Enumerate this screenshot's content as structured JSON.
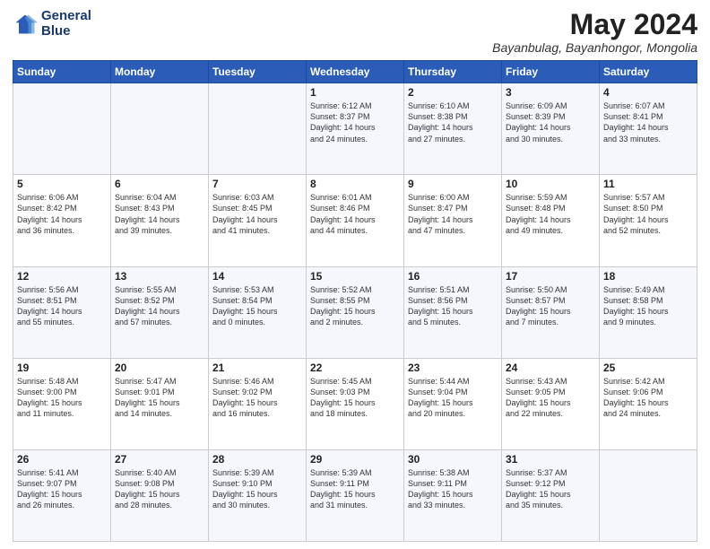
{
  "logo": {
    "line1": "General",
    "line2": "Blue"
  },
  "title": "May 2024",
  "subtitle": "Bayanbulag, Bayanhongor, Mongolia",
  "weekdays": [
    "Sunday",
    "Monday",
    "Tuesday",
    "Wednesday",
    "Thursday",
    "Friday",
    "Saturday"
  ],
  "weeks": [
    [
      {
        "day": "",
        "info": ""
      },
      {
        "day": "",
        "info": ""
      },
      {
        "day": "",
        "info": ""
      },
      {
        "day": "1",
        "info": "Sunrise: 6:12 AM\nSunset: 8:37 PM\nDaylight: 14 hours\nand 24 minutes."
      },
      {
        "day": "2",
        "info": "Sunrise: 6:10 AM\nSunset: 8:38 PM\nDaylight: 14 hours\nand 27 minutes."
      },
      {
        "day": "3",
        "info": "Sunrise: 6:09 AM\nSunset: 8:39 PM\nDaylight: 14 hours\nand 30 minutes."
      },
      {
        "day": "4",
        "info": "Sunrise: 6:07 AM\nSunset: 8:41 PM\nDaylight: 14 hours\nand 33 minutes."
      }
    ],
    [
      {
        "day": "5",
        "info": "Sunrise: 6:06 AM\nSunset: 8:42 PM\nDaylight: 14 hours\nand 36 minutes."
      },
      {
        "day": "6",
        "info": "Sunrise: 6:04 AM\nSunset: 8:43 PM\nDaylight: 14 hours\nand 39 minutes."
      },
      {
        "day": "7",
        "info": "Sunrise: 6:03 AM\nSunset: 8:45 PM\nDaylight: 14 hours\nand 41 minutes."
      },
      {
        "day": "8",
        "info": "Sunrise: 6:01 AM\nSunset: 8:46 PM\nDaylight: 14 hours\nand 44 minutes."
      },
      {
        "day": "9",
        "info": "Sunrise: 6:00 AM\nSunset: 8:47 PM\nDaylight: 14 hours\nand 47 minutes."
      },
      {
        "day": "10",
        "info": "Sunrise: 5:59 AM\nSunset: 8:48 PM\nDaylight: 14 hours\nand 49 minutes."
      },
      {
        "day": "11",
        "info": "Sunrise: 5:57 AM\nSunset: 8:50 PM\nDaylight: 14 hours\nand 52 minutes."
      }
    ],
    [
      {
        "day": "12",
        "info": "Sunrise: 5:56 AM\nSunset: 8:51 PM\nDaylight: 14 hours\nand 55 minutes."
      },
      {
        "day": "13",
        "info": "Sunrise: 5:55 AM\nSunset: 8:52 PM\nDaylight: 14 hours\nand 57 minutes."
      },
      {
        "day": "14",
        "info": "Sunrise: 5:53 AM\nSunset: 8:54 PM\nDaylight: 15 hours\nand 0 minutes."
      },
      {
        "day": "15",
        "info": "Sunrise: 5:52 AM\nSunset: 8:55 PM\nDaylight: 15 hours\nand 2 minutes."
      },
      {
        "day": "16",
        "info": "Sunrise: 5:51 AM\nSunset: 8:56 PM\nDaylight: 15 hours\nand 5 minutes."
      },
      {
        "day": "17",
        "info": "Sunrise: 5:50 AM\nSunset: 8:57 PM\nDaylight: 15 hours\nand 7 minutes."
      },
      {
        "day": "18",
        "info": "Sunrise: 5:49 AM\nSunset: 8:58 PM\nDaylight: 15 hours\nand 9 minutes."
      }
    ],
    [
      {
        "day": "19",
        "info": "Sunrise: 5:48 AM\nSunset: 9:00 PM\nDaylight: 15 hours\nand 11 minutes."
      },
      {
        "day": "20",
        "info": "Sunrise: 5:47 AM\nSunset: 9:01 PM\nDaylight: 15 hours\nand 14 minutes."
      },
      {
        "day": "21",
        "info": "Sunrise: 5:46 AM\nSunset: 9:02 PM\nDaylight: 15 hours\nand 16 minutes."
      },
      {
        "day": "22",
        "info": "Sunrise: 5:45 AM\nSunset: 9:03 PM\nDaylight: 15 hours\nand 18 minutes."
      },
      {
        "day": "23",
        "info": "Sunrise: 5:44 AM\nSunset: 9:04 PM\nDaylight: 15 hours\nand 20 minutes."
      },
      {
        "day": "24",
        "info": "Sunrise: 5:43 AM\nSunset: 9:05 PM\nDaylight: 15 hours\nand 22 minutes."
      },
      {
        "day": "25",
        "info": "Sunrise: 5:42 AM\nSunset: 9:06 PM\nDaylight: 15 hours\nand 24 minutes."
      }
    ],
    [
      {
        "day": "26",
        "info": "Sunrise: 5:41 AM\nSunset: 9:07 PM\nDaylight: 15 hours\nand 26 minutes."
      },
      {
        "day": "27",
        "info": "Sunrise: 5:40 AM\nSunset: 9:08 PM\nDaylight: 15 hours\nand 28 minutes."
      },
      {
        "day": "28",
        "info": "Sunrise: 5:39 AM\nSunset: 9:10 PM\nDaylight: 15 hours\nand 30 minutes."
      },
      {
        "day": "29",
        "info": "Sunrise: 5:39 AM\nSunset: 9:11 PM\nDaylight: 15 hours\nand 31 minutes."
      },
      {
        "day": "30",
        "info": "Sunrise: 5:38 AM\nSunset: 9:11 PM\nDaylight: 15 hours\nand 33 minutes."
      },
      {
        "day": "31",
        "info": "Sunrise: 5:37 AM\nSunset: 9:12 PM\nDaylight: 15 hours\nand 35 minutes."
      },
      {
        "day": "",
        "info": ""
      }
    ]
  ]
}
